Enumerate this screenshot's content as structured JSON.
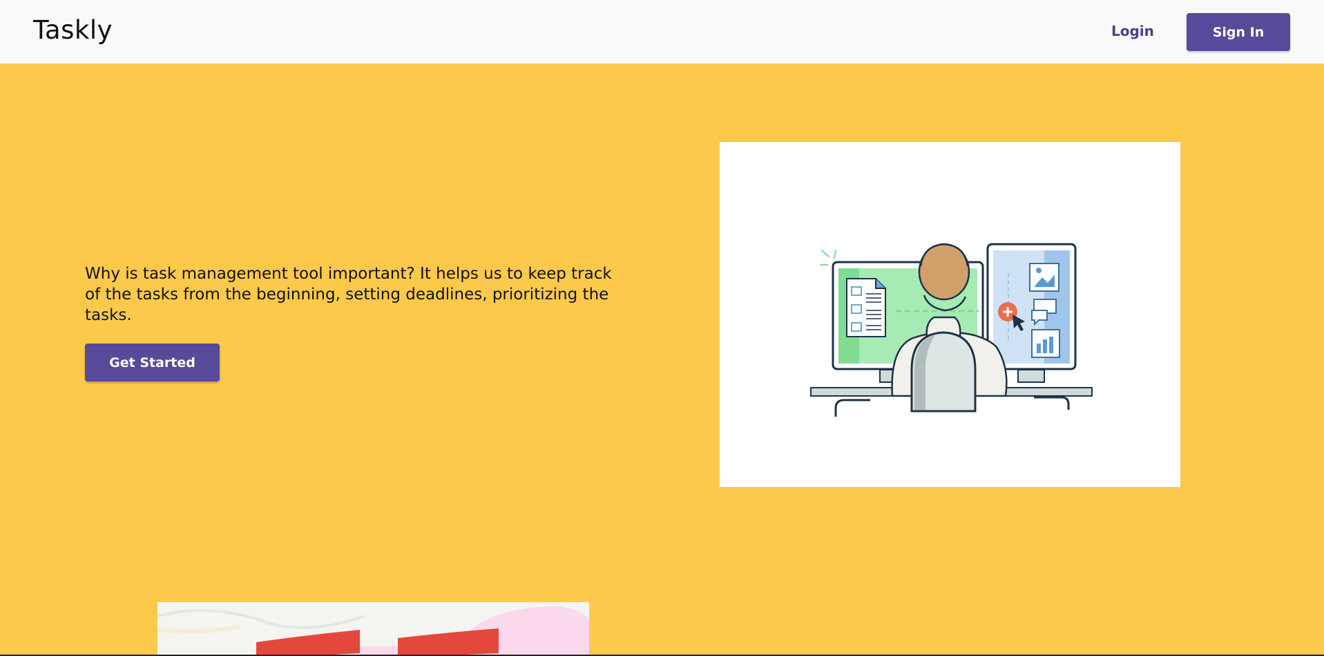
{
  "navbar": {
    "brand": "Taskly",
    "login_label": "Login",
    "signin_label": "Sign In"
  },
  "hero": {
    "description": "Why is task management tool important? It helps us to keep track of the tasks from the beginning, setting deadlines, prioritizing the tasks.",
    "cta_label": "Get Started"
  },
  "colors": {
    "background": "#fdc94b",
    "navbar": "#f9f9f9",
    "primary_button": "#574a9a",
    "login_link": "#4a3f8c"
  },
  "images": {
    "hero_illustration": "person-at-desk-with-two-monitors-illustration",
    "bottom_image": "red-brush-strokes-illustration"
  }
}
